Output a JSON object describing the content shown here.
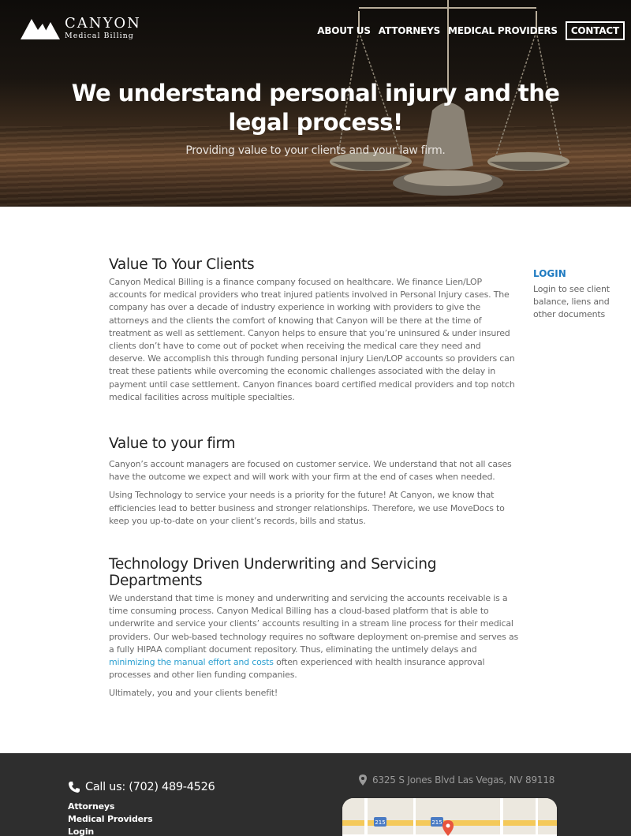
{
  "brand": {
    "name": "CANYON",
    "sub": "Medical Billing"
  },
  "nav": {
    "items": [
      "ABOUT US",
      "ATTORNEYS",
      "MEDICAL PROVIDERS"
    ],
    "contact": "CONTACT"
  },
  "hero": {
    "title": "We understand personal injury and the legal process!",
    "subtitle": "Providing value to your clients and your law firm."
  },
  "sections": [
    {
      "heading": "Value To Your Clients",
      "paragraphs": [
        "Canyon Medical Billing is a finance company focused on healthcare. We finance Lien/LOP accounts for medical providers who treat injured patients involved in Personal Injury cases. The company has over a decade of industry experience in working with providers to give the attorneys and the clients the comfort of knowing that Canyon will be there at the time of treatment as well as settlement. Canyon helps to ensure that you’re uninsured & under insured clients don’t have to come out of pocket when receiving the medical care they need and deserve. We accomplish this through funding personal injury Lien/LOP accounts so providers can treat these patients while overcoming the economic challenges associated with the delay in payment until case settlement. Canyon finances board certified medical providers and top notch medical facilities across multiple specialties."
      ]
    },
    {
      "heading": "Value to your firm",
      "paragraphs": [
        "Canyon’s account managers are focused on customer service. We understand that not all cases have the outcome we expect and will work with your firm at the end of cases when needed.",
        "Using Technology to service your needs is a priority for the future! At Canyon, we know that efficiencies lead to better business and stronger relationships. Therefore, we use MoveDocs to keep you up-to-date on your client’s records, bills and status."
      ]
    },
    {
      "heading": "Technology Driven Underwriting and Servicing Departments",
      "p1_before": "We understand that time is money and underwriting and servicing the accounts receivable is a time consuming process. Canyon Medical Billing has a cloud-based platform that is able to underwrite and service your clients’ accounts resulting in a stream line process for their medical providers. Our web-based technology requires no software deployment on-premise and serves as a fully HIPAA compliant document repository. Thus, eliminating the untimely delays and ",
      "p1_link": "minimizing the manual effort and costs",
      "p1_after": " often experienced with health insurance approval processes and other lien funding companies.",
      "p2": "Ultimately, you and your clients benefit!"
    }
  ],
  "sidebar": {
    "login_label": "LOGIN",
    "login_text": "Login to see client balance, liens and other documents"
  },
  "footer": {
    "phone": "Call us: (702) 489-4526",
    "links": [
      "Attorneys",
      "Medical Providers",
      "Login"
    ],
    "address": "6325 S Jones Blvd Las Vegas, NV 89118",
    "map_labels": [
      "215",
      "215"
    ]
  },
  "colors": {
    "link": "#2a9fd0",
    "login": "#1f7bc1",
    "footer_bg": "#2e2e2e",
    "marker": "#e8553e"
  }
}
